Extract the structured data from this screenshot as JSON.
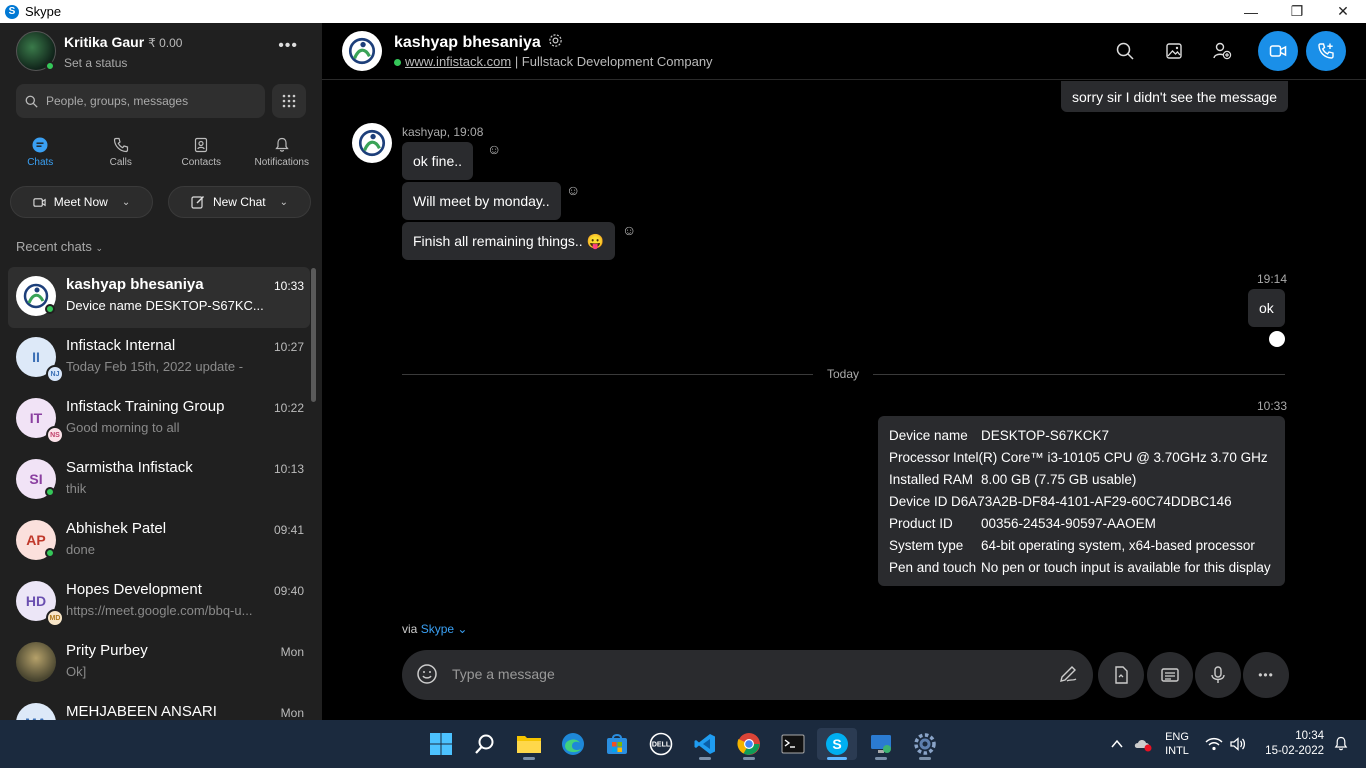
{
  "window": {
    "title": "Skype"
  },
  "profile": {
    "name": "Kritika Gaur",
    "credit": "₹ 0.00",
    "status": "Set a status"
  },
  "search": {
    "placeholder": "People, groups, messages"
  },
  "nav": {
    "chats": "Chats",
    "calls": "Calls",
    "contacts": "Contacts",
    "notifications": "Notifications"
  },
  "actions": {
    "meet_now": "Meet Now",
    "new_chat": "New Chat"
  },
  "recent_label": "Recent chats",
  "chats": [
    {
      "name": "kashyap bhesaniya",
      "time": "10:33",
      "preview": "Device name    DESKTOP-S67KC...",
      "initials": "",
      "badge": ""
    },
    {
      "name": "Infistack Internal",
      "time": "10:27",
      "preview": "Today Feb 15th, 2022 update -",
      "initials": "II",
      "badge": "NJ"
    },
    {
      "name": "Infistack Training Group",
      "time": "10:22",
      "preview": "Good morning to all",
      "initials": "IT",
      "badge": "NS"
    },
    {
      "name": "Sarmistha Infistack",
      "time": "10:13",
      "preview": "thik",
      "initials": "SI",
      "badge": ""
    },
    {
      "name": "Abhishek Patel",
      "time": "09:41",
      "preview": "done",
      "initials": "AP",
      "badge": ""
    },
    {
      "name": "Hopes Development",
      "time": "09:40",
      "preview": "https://meet.google.com/bbq-u...",
      "initials": "HD",
      "badge": "MD"
    },
    {
      "name": "Prity Purbey",
      "time": "Mon",
      "preview": "Ok]",
      "initials": "",
      "badge": ""
    },
    {
      "name": "MEHJABEEN ANSARI",
      "time": "Mon",
      "preview": "",
      "initials": "MA",
      "badge": ""
    }
  ],
  "header": {
    "name": "kashyap bhesaniya",
    "link": "www.infistack.com",
    "tagline": " | Fullstack Development Company"
  },
  "messages": {
    "top_outgoing": "sorry sir I didn't  see the message",
    "sender_meta": "kashyap, 19:08",
    "incoming": [
      "ok fine..",
      "Will meet by monday..",
      "Finish all remaining things.. 😛"
    ],
    "outgoing_time": "19:14",
    "outgoing": "ok",
    "divider": "Today",
    "card_time": "10:33",
    "card": [
      {
        "label": "Device name",
        "value": "DESKTOP-S67KCK7"
      },
      {
        "label": "Processor",
        "value": "Intel(R) Core™ i3-10105 CPU @ 3.70GHz   3.70 GHz"
      },
      {
        "label": "Installed RAM",
        "value": "8.00 GB (7.75 GB usable)"
      },
      {
        "label": "Device ID",
        "value": "D6A73A2B-DF84-4101-AF29-60C74DDBC146"
      },
      {
        "label": "Product ID",
        "value": "00356-24534-90597-AAOEM"
      },
      {
        "label": "System type",
        "value": "64-bit operating system, x64-based processor"
      },
      {
        "label": "Pen and touch",
        "value": "No pen or touch input is available for this display"
      }
    ]
  },
  "composer": {
    "via": "via",
    "via_app": "Skype",
    "placeholder": "Type a message"
  },
  "taskbar": {
    "lang": "ENG",
    "layout": "INTL",
    "time": "10:34",
    "date": "15-02-2022"
  },
  "colors": {
    "accent": "#1a8fe8",
    "online": "#35c759",
    "bubble": "#2a2b2e",
    "taskbar": "#1b2a3e"
  }
}
